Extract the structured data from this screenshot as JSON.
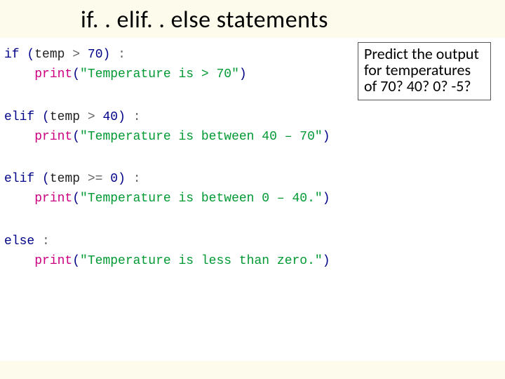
{
  "title": {
    "text": "if. . elif. . else statements"
  },
  "predict": {
    "text": "Predict the output for temperatures of 70? 40? 0? -5?"
  },
  "code": {
    "l1": {
      "kw": "if",
      "var": "temp",
      "op": ">",
      "num": "70"
    },
    "l2": {
      "fn": "print",
      "str": "\"Temperature is > 70\""
    },
    "l3": {
      "kw": "elif",
      "var": "temp",
      "op": ">",
      "num": "40"
    },
    "l4": {
      "fn": "print",
      "str": "\"Temperature is between 40 – 70\""
    },
    "l5": {
      "kw": "elif",
      "var": "temp",
      "op": ">=",
      "num": "0"
    },
    "l6": {
      "fn": "print",
      "str": "\"Temperature is between 0 – 40.\""
    },
    "l7": {
      "kw": "else"
    },
    "l8": {
      "fn": "print",
      "str": "\"Temperature is less than zero.\""
    }
  }
}
